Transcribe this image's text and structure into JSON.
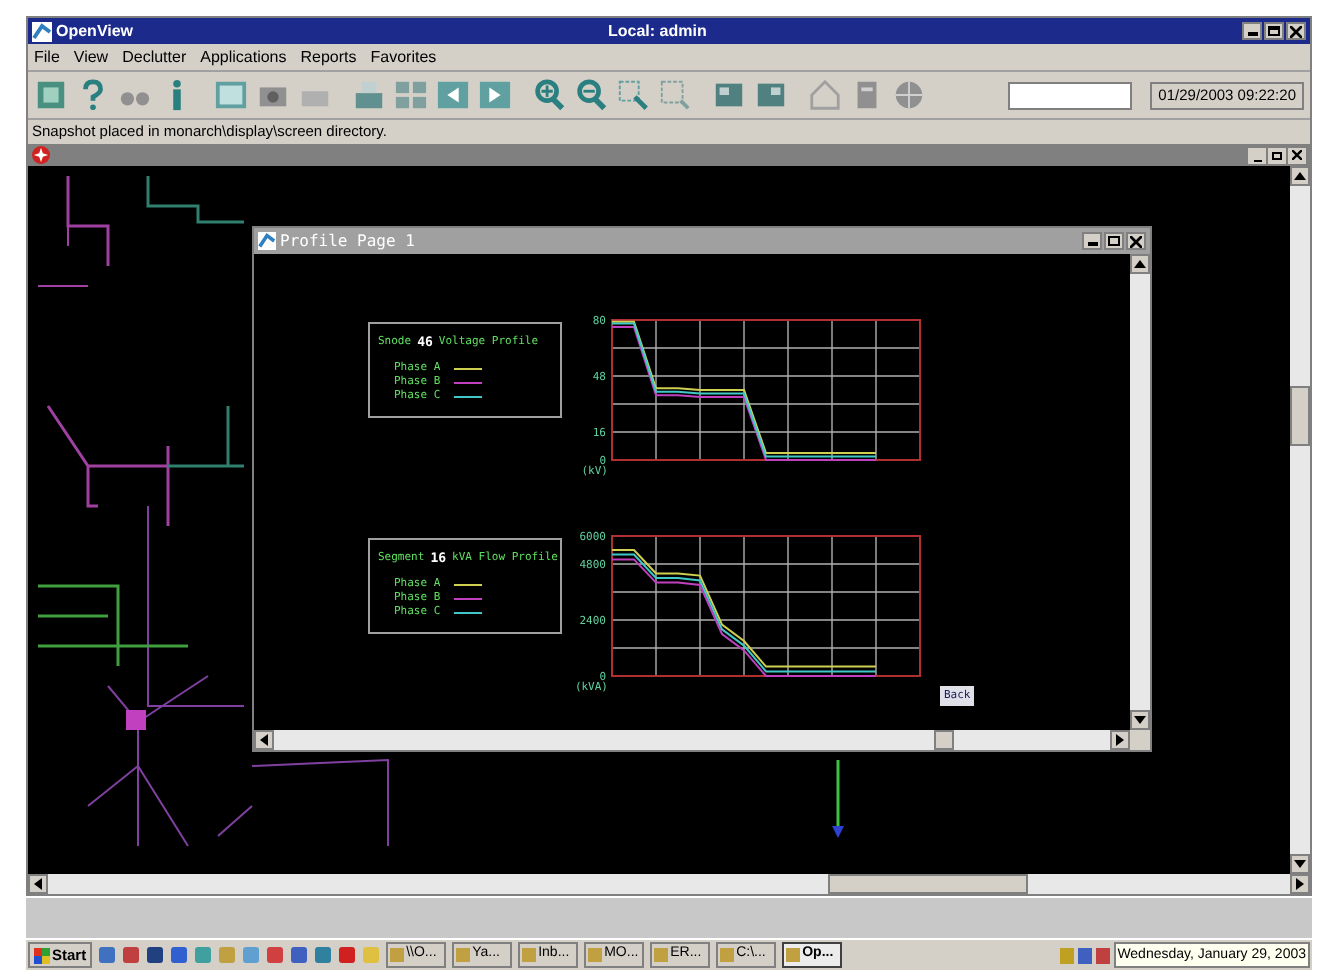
{
  "window": {
    "title": "OpenView",
    "subtitle": "Local: admin"
  },
  "menu": [
    "File",
    "View",
    "Declutter",
    "Applications",
    "Reports",
    "Favorites"
  ],
  "toolbar": {
    "datetime": "01/29/2003 09:22:20"
  },
  "status_message": "Snapshot placed in monarch\\display\\screen directory.",
  "profile_window": {
    "title": "Profile Page 1",
    "back_button": "Back",
    "panels": [
      {
        "legend": {
          "label": "Snode",
          "id": "46",
          "title": "Voltage Profile"
        },
        "chart_data": {
          "type": "line",
          "ylabel": "(kV)",
          "grid": true,
          "categories": [
            null,
            null,
            null,
            null,
            null,
            null,
            null,
            null,
            null,
            null,
            null,
            null,
            null,
            null,
            null
          ],
          "ylim": [
            0,
            80
          ],
          "yticks": [
            {
              "value": 0,
              "label": "0"
            },
            {
              "value": 16,
              "label": "16"
            },
            {
              "value": 48,
              "label": "48"
            },
            {
              "value": 80,
              "label": "80"
            }
          ],
          "series": [
            {
              "name": "Phase A",
              "color": "#d0d050",
              "values": [
                79,
                79,
                41,
                41,
                40,
                40,
                40,
                4,
                4,
                4,
                4,
                4,
                4,
                null,
                null
              ]
            },
            {
              "name": "Phase B",
              "color": "#c040c0",
              "values": [
                76,
                76,
                37,
                37,
                36,
                36,
                36,
                0,
                0,
                0,
                0,
                0,
                0,
                null,
                null
              ]
            },
            {
              "name": "Phase C",
              "color": "#40c8c8",
              "values": [
                78,
                78,
                39,
                39,
                38,
                38,
                38,
                2,
                2,
                2,
                2,
                2,
                2,
                null,
                null
              ]
            }
          ]
        }
      },
      {
        "legend": {
          "label": "Segment",
          "id": "16",
          "title": "kVA Flow Profile"
        },
        "chart_data": {
          "type": "line",
          "ylabel": "(kVA)",
          "grid": true,
          "categories": [
            null,
            null,
            null,
            null,
            null,
            null,
            null,
            null,
            null,
            null,
            null,
            null,
            null,
            null,
            null
          ],
          "ylim": [
            0,
            6000
          ],
          "yticks": [
            0,
            2400,
            4800,
            6000
          ],
          "series": [
            {
              "name": "Phase A",
              "color": "#d0d050",
              "values": [
                5400,
                5400,
                4400,
                4400,
                4300,
                2200,
                1500,
                400,
                400,
                400,
                400,
                400,
                400,
                null,
                null
              ]
            },
            {
              "name": "Phase B",
              "color": "#c040c0",
              "values": [
                5000,
                5000,
                4000,
                4000,
                3900,
                1800,
                1100,
                0,
                0,
                0,
                0,
                0,
                0,
                null,
                null
              ]
            },
            {
              "name": "Phase C",
              "color": "#40c8c8",
              "values": [
                5200,
                5200,
                4200,
                4200,
                4100,
                2000,
                1300,
                200,
                200,
                200,
                200,
                200,
                200,
                null,
                null
              ]
            }
          ]
        }
      }
    ]
  },
  "taskbar": {
    "start": "Start",
    "buttons": [
      {
        "label": "\\\\O...",
        "selected": false
      },
      {
        "label": "Ya...",
        "selected": false
      },
      {
        "label": "Inb...",
        "selected": false
      },
      {
        "label": "MO...",
        "selected": false
      },
      {
        "label": "ER...",
        "selected": false
      },
      {
        "label": "C:\\...",
        "selected": false
      },
      {
        "label": "Op...",
        "selected": true
      }
    ],
    "clock": "Wednesday, January 29, 2003"
  }
}
